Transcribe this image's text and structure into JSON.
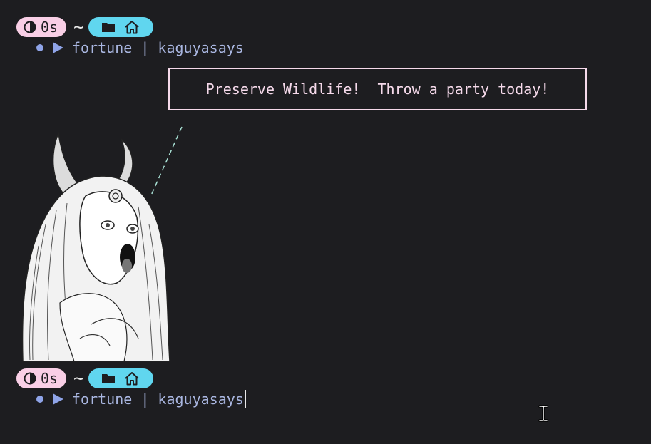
{
  "prompts": [
    {
      "duration": "0s",
      "cwd_symbol": "~",
      "command": "fortune | kaguyasays"
    },
    {
      "duration": "0s",
      "cwd_symbol": "~",
      "command": "fortune | kaguyasays"
    }
  ],
  "fortune_text": "Preserve Wildlife!  Throw a party today!",
  "icons": {
    "timer": "half-moon-timer-icon",
    "folder": "folder-icon",
    "home": "home-icon",
    "status": "status-dot-icon",
    "prompt_arrow": "play-arrow-icon",
    "mouse": "i-beam-cursor-icon"
  },
  "colors": {
    "background": "#1d1d20",
    "time_badge": "#f9cfe6",
    "dir_badge": "#60d6ef",
    "command_text": "#a9b6e0",
    "prompt_symbols": "#8fa4e8",
    "fortune_border": "#f5d9ea",
    "speech_tail": "#a8e0d4"
  }
}
